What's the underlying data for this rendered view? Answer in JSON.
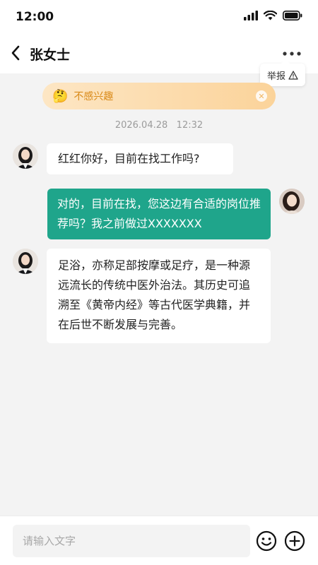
{
  "status_bar": {
    "time": "12:00"
  },
  "header": {
    "title": "张女士",
    "report_label": "举报"
  },
  "banner": {
    "emoji": "🤔",
    "label": "不感兴趣",
    "close_symbol": "✕"
  },
  "timestamp": "2026.04.28   12:32",
  "messages": [
    {
      "side": "left",
      "text": "红红你好，目前在找工作吗?"
    },
    {
      "side": "right",
      "text": "对的，目前在找，您这边有合适的岗位推荐吗？我之前做过XXXXXXX"
    },
    {
      "side": "left",
      "text": "足浴，亦称足部按摩或足疗，是一种源远流长的传统中医外治法。其历史可追溯至《黄帝内经》等古代医学典籍，并在后世不断发展与完善。"
    }
  ],
  "input": {
    "placeholder": "请输入文字"
  },
  "colors": {
    "accent": "#1fa58b",
    "banner_text": "#d98a18",
    "background": "#f3f3f3"
  },
  "icons": [
    "signal-icon",
    "wifi-icon",
    "battery-icon",
    "back-icon",
    "more-icon",
    "warning-icon",
    "thinking-emoji",
    "close-icon",
    "emoji-icon",
    "plus-icon"
  ]
}
